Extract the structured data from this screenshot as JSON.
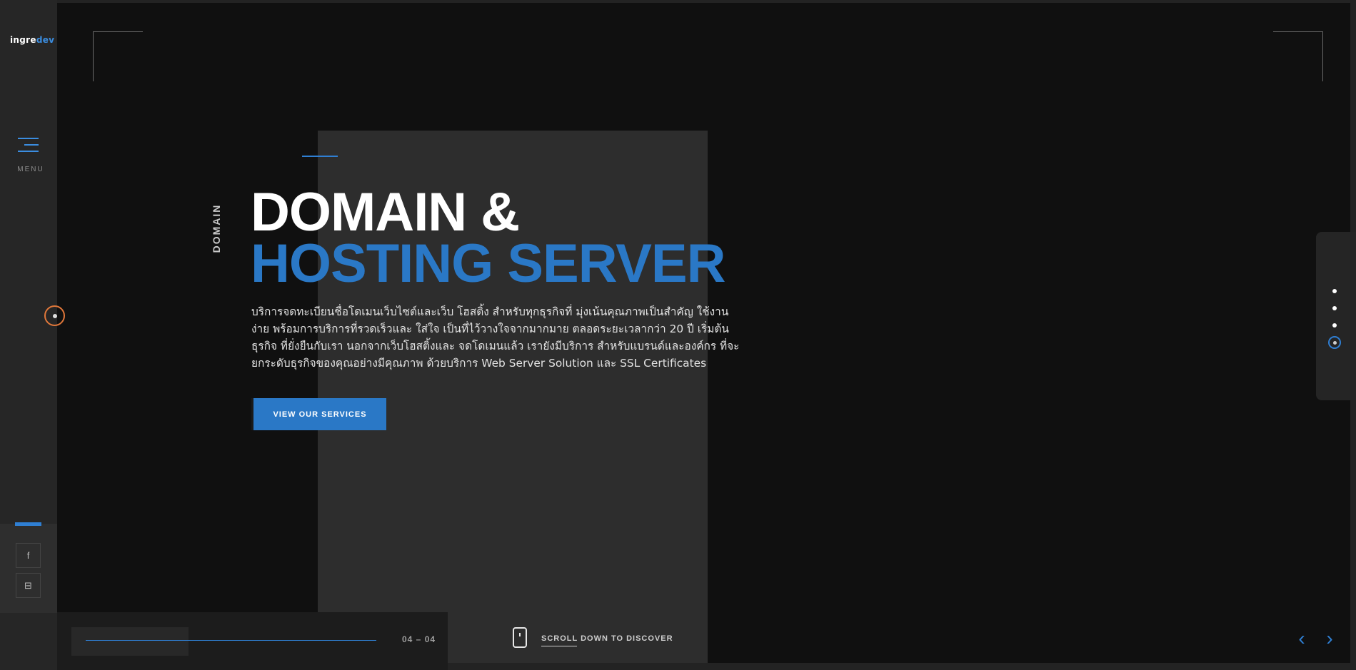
{
  "brand": {
    "logo_part1": "ingre",
    "logo_part2": "dev"
  },
  "sidebar": {
    "menu_label": "MENU",
    "social": [
      {
        "icon": "facebook-icon",
        "glyph": "f"
      },
      {
        "icon": "line-icon",
        "glyph": "⊟"
      }
    ]
  },
  "hero": {
    "vertical_label": "DOMAIN",
    "title_line1": "DOMAIN &",
    "title_line2": "HOSTING SERVER",
    "description": "บริการจดทะเบียนชื่อโดเมนเว็บไซต์และเว็บ โฮสติ้ง สำหรับทุกธุรกิจที่ มุ่งเน้นคุณภาพเป็นสำคัญ ใช้งานง่าย พร้อมการบริการที่รวดเร็วและ ใส่ใจ เป็นที่ไว้วางใจจากมากมาย ตลอดระยะเวลากว่า 20 ปี เริ่มต้นธุรกิจ ที่ยั่งยืนกับเรา นอกจากเว็บโฮสติ้งและ จดโดเมนแล้ว เรายังมีบริการ สำหรับแบรนด์และองค์กร ที่จะยกระดับธุรกิจของคุณอย่างมีคุณภาพ ด้วยบริการ Web Server Solution และ SSL Certificates",
    "cta_label": "VIEW OUR SERVICES"
  },
  "slider": {
    "counter": "04 – 04",
    "progress": 1.0,
    "scroll_label": "SCROLL DOWN TO DISCOVER",
    "prev_glyph": "‹",
    "next_glyph": "›",
    "pagination_count": 4,
    "active_index": 4
  },
  "colors": {
    "accent": "#2a78c6",
    "highlight_ring": "#e0773a",
    "background": "#101010",
    "panel": "#2d2d2d"
  }
}
